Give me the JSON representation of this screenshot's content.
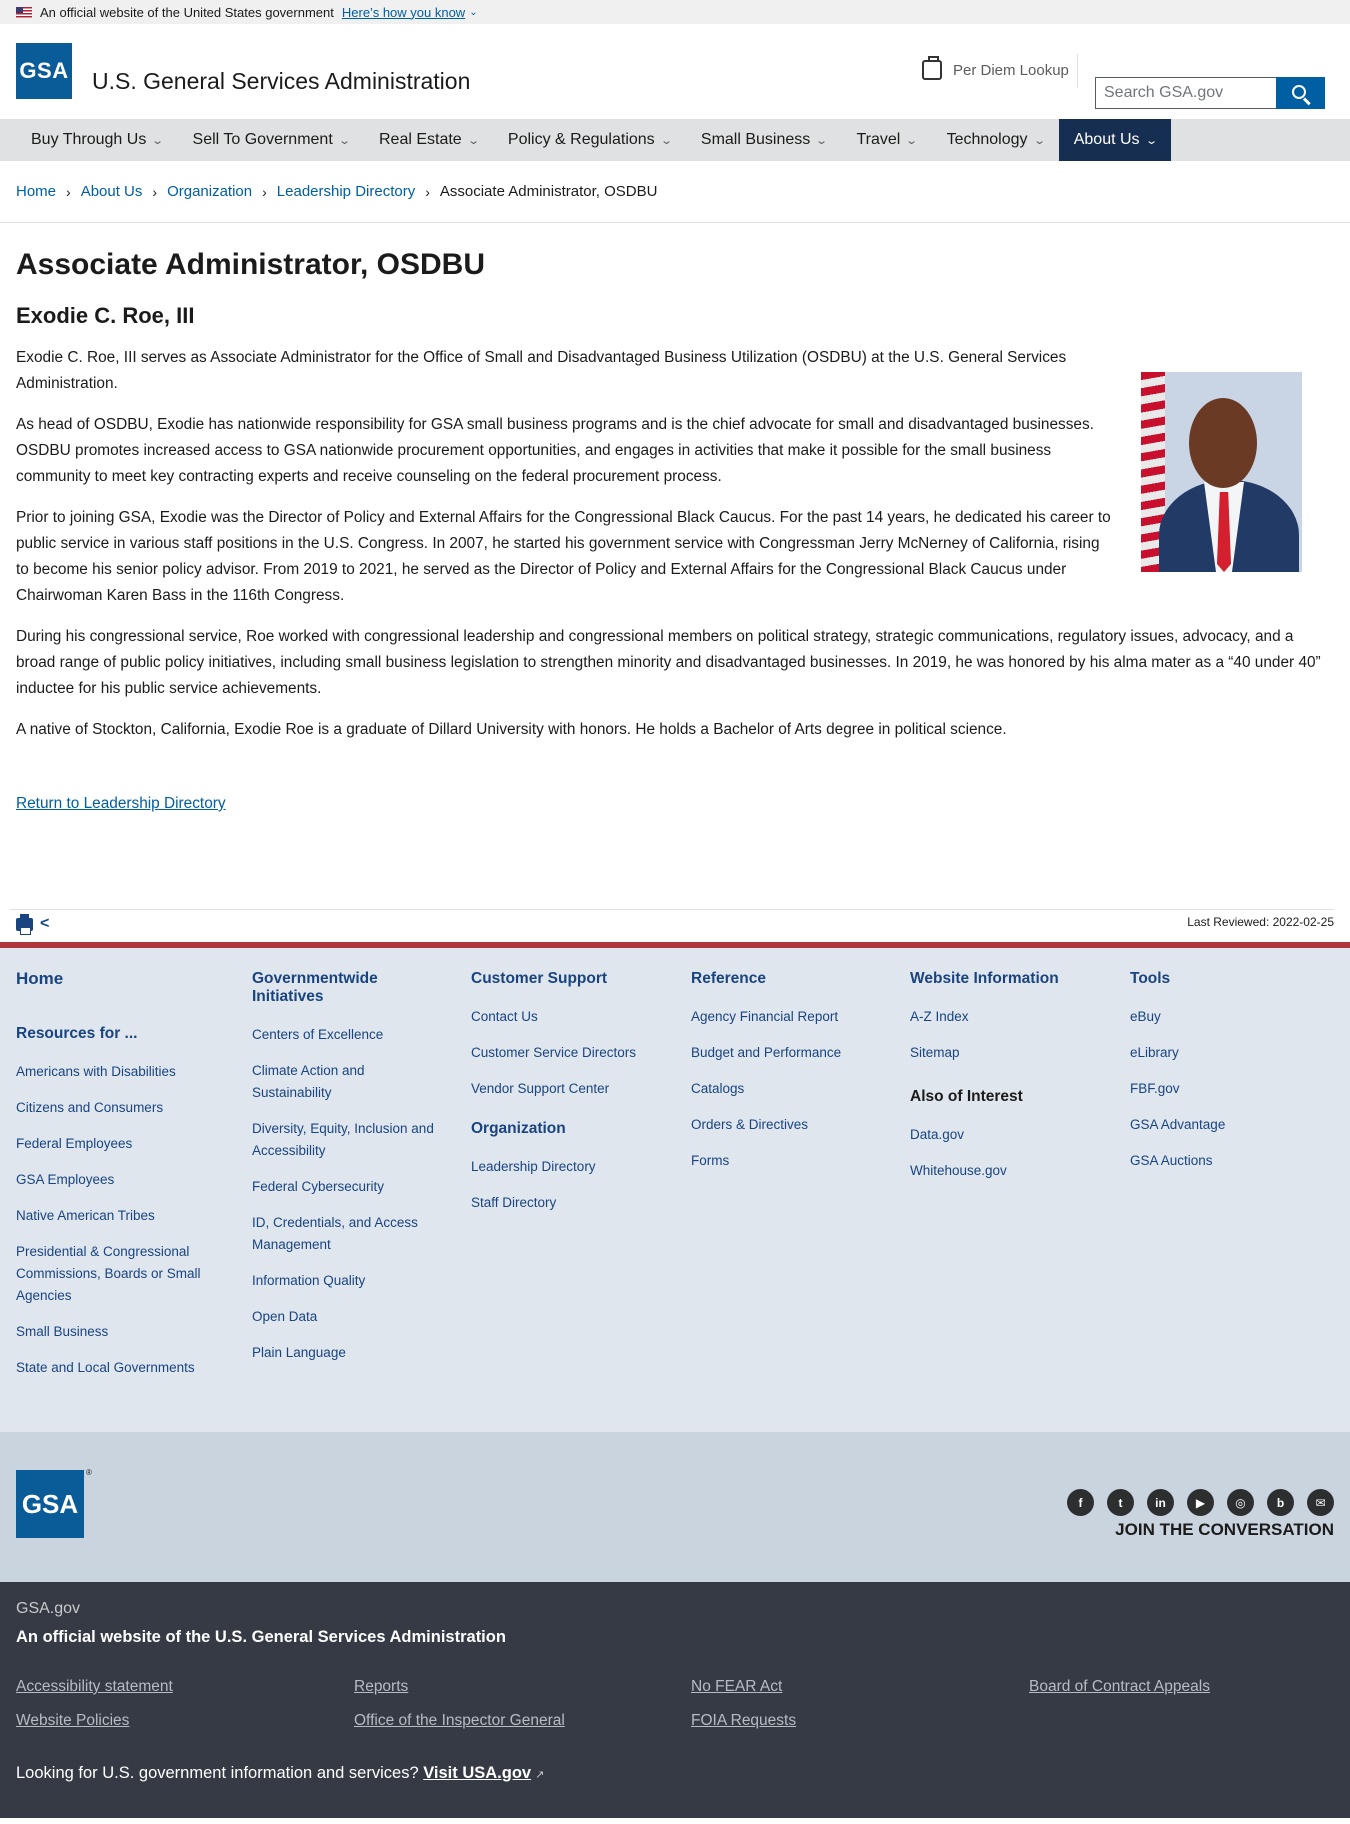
{
  "banner": {
    "text": "An official website of the United States government",
    "link": "Here’s how you know"
  },
  "header": {
    "logo_text": "GSA",
    "title": "U.S. General Services Administration",
    "per_diem": "Per Diem Lookup",
    "search_placeholder": "Search GSA.gov"
  },
  "nav": [
    {
      "label": "Buy Through Us"
    },
    {
      "label": "Sell To Government"
    },
    {
      "label": "Real Estate"
    },
    {
      "label": "Policy & Regulations"
    },
    {
      "label": "Small Business"
    },
    {
      "label": "Travel"
    },
    {
      "label": "Technology"
    },
    {
      "label": "About Us",
      "active": true
    }
  ],
  "breadcrumb": {
    "items": [
      "Home",
      "About Us",
      "Organization",
      "Leadership Directory"
    ],
    "current": "Associate Administrator, OSDBU"
  },
  "page": {
    "title": "Associate Administrator, OSDBU",
    "name": "Exodie C. Roe, III",
    "paragraphs": [
      "Exodie C. Roe, III serves as Associate Administrator for the Office of Small and Disadvantaged Business Utilization (OSDBU) at the U.S. General Services Administration.",
      "As head of OSDBU, Exodie has nationwide responsibility for GSA small business programs and is the chief advocate for small and disadvantaged businesses. OSDBU promotes increased access to GSA nationwide procurement opportunities, and engages in activities that make it possible for the small business community to meet key contracting experts and receive counseling on the federal procurement process.",
      "Prior to joining GSA, Exodie was the Director of Policy and External Affairs for the Congressional Black Caucus. For the past 14 years, he dedicated his career to public service in various staff positions in the U.S. Congress. In 2007, he started his government service with Congressman Jerry McNerney of California, rising to become his senior policy advisor. From 2019 to 2021, he served as the Director of Policy and External Affairs for the Congressional Black Caucus under Chairwoman Karen Bass in the 116th Congress.",
      "During his congressional service, Roe worked with congressional leadership and congressional members on political strategy, strategic communications, regulatory issues, advocacy, and a broad range of public policy initiatives, including small business legislation to strengthen minority and disadvantaged businesses. In 2019, he was honored by his alma mater as a “40 under 40” inductee for his public service achievements.",
      "A native of Stockton, California, Exodie Roe is a graduate of Dillard University with honors. He holds a Bachelor of Arts degree in political science."
    ],
    "return_link": "Return to Leadership Directory",
    "last_reviewed": "Last Reviewed: 2022-02-25"
  },
  "footer": {
    "home": "Home",
    "resources_heading": "Resources for ...",
    "resources": [
      "Americans with Disabilities",
      "Citizens and Consumers",
      "Federal Employees",
      "GSA Employees",
      "Native American Tribes",
      "Presidential & Congressional Commissions, Boards or Small Agencies",
      "Small Business",
      "State and Local Governments"
    ],
    "initiatives_heading": "Governmentwide Initiatives",
    "initiatives": [
      "Centers of Excellence",
      "Climate Action and Sustainability",
      "Diversity, Equity, Inclusion and Accessibility",
      "Federal Cybersecurity",
      "ID, Credentials, and Access Management",
      "Information Quality",
      "Open Data",
      "Plain Language"
    ],
    "support_heading": "Customer Support",
    "support": [
      "Contact Us",
      "Customer Service Directors",
      "Vendor Support Center"
    ],
    "org_heading": "Organization",
    "org": [
      "Leadership Directory",
      "Staff Directory"
    ],
    "reference_heading": "Reference",
    "reference": [
      "Agency Financial Report",
      "Budget and Performance",
      "Catalogs",
      "Orders & Directives",
      "Forms"
    ],
    "website_heading": "Website Information",
    "website": [
      "A-Z Index",
      "Sitemap"
    ],
    "interest_heading": "Also of Interest",
    "interest": [
      "Data.gov",
      "Whitehouse.gov"
    ],
    "tools_heading": "Tools",
    "tools": [
      "eBuy",
      "eLibrary",
      "FBF.gov",
      "GSA Advantage",
      "GSA Auctions"
    ],
    "logo_text": "GSA",
    "registered": "®",
    "socials": [
      {
        "name": "facebook-icon",
        "glyph": "f"
      },
      {
        "name": "twitter-icon",
        "glyph": "t"
      },
      {
        "name": "linkedin-icon",
        "glyph": "in"
      },
      {
        "name": "youtube-icon",
        "glyph": "▶"
      },
      {
        "name": "instagram-icon",
        "glyph": "◎"
      },
      {
        "name": "blog-icon",
        "glyph": "b"
      },
      {
        "name": "email-icon",
        "glyph": "✉"
      }
    ],
    "join": "JOIN THE CONVERSATION",
    "site": "GSA.gov",
    "official": "An official website of the U.S. General Services Administration",
    "links": [
      "Accessibility statement",
      "Reports",
      "No FEAR Act",
      "Board of Contract Appeals",
      "Website Policies",
      "Office of the Inspector General",
      "FOIA Requests"
    ],
    "usa_text": "Looking for U.S. government information and services?",
    "usa_link": "Visit USA.gov"
  }
}
